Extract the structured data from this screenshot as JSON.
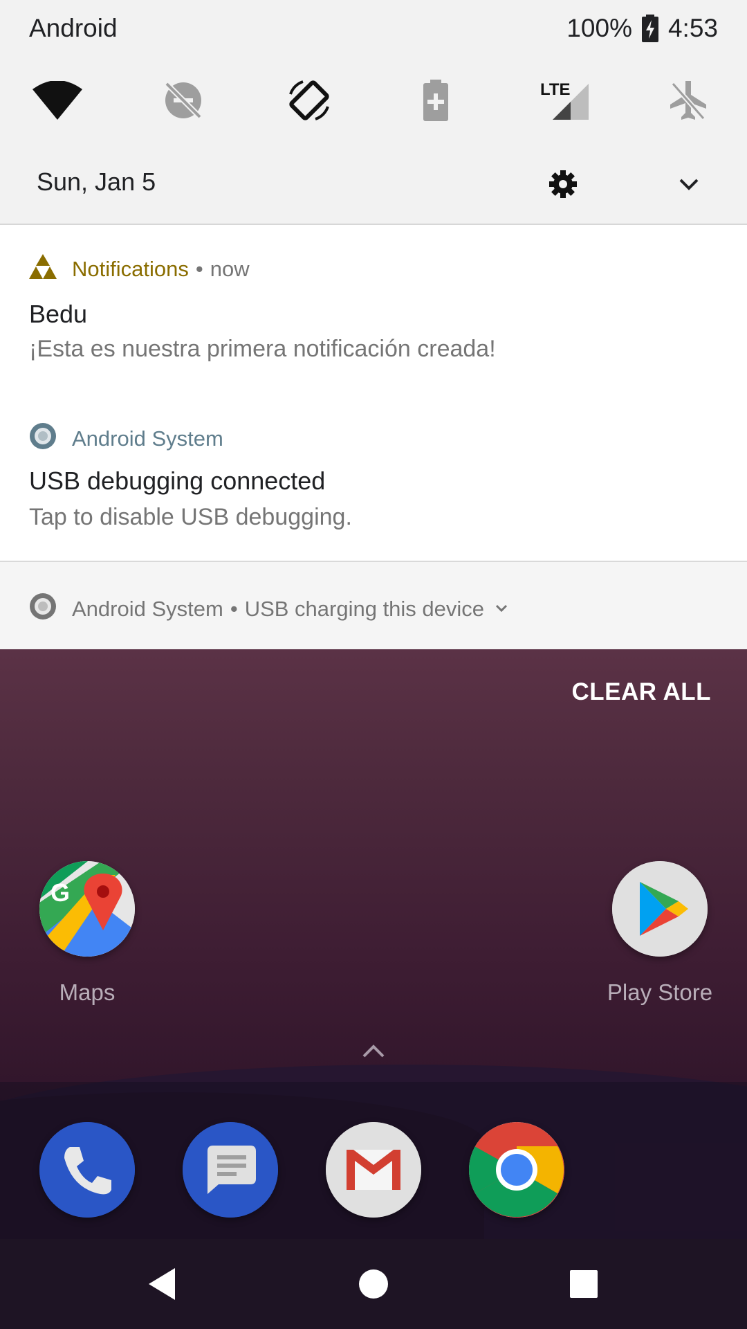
{
  "status_bar": {
    "carrier": "Android",
    "battery_percent": "100%",
    "time": "4:53",
    "icons": [
      "battery-charging-icon"
    ]
  },
  "quick_settings": {
    "tiles": [
      {
        "name": "wifi-icon"
      },
      {
        "name": "do-not-disturb-off-icon"
      },
      {
        "name": "auto-rotate-icon"
      },
      {
        "name": "battery-saver-icon"
      },
      {
        "name": "lte-signal-icon",
        "label": "LTE"
      },
      {
        "name": "airplane-mode-icon"
      }
    ],
    "date": "Sun, Jan 5",
    "settings_icon": "gear-icon",
    "expand_icon": "chevron-down-icon"
  },
  "notifications": [
    {
      "app_name": "Notifications",
      "separator": "•",
      "time": "now",
      "title": "Bedu",
      "body": "¡Esta es nuestra primera notificación creada!",
      "app_color": "#8a6d00",
      "icon": "triforce-icon"
    },
    {
      "app_name": "Android System",
      "title": "USB debugging connected",
      "body": "Tap to disable USB debugging.",
      "app_color": "#5f7d8c",
      "icon": "android-system-icon"
    }
  ],
  "collapsed_notification": {
    "app_name": "Android System",
    "separator": "•",
    "text": "USB charging this device",
    "icon": "android-system-icon"
  },
  "home": {
    "clear_all": "CLEAR ALL",
    "apps": [
      {
        "label": "Maps",
        "icon": "maps-icon"
      },
      {
        "label": "Play Store",
        "icon": "play-store-icon"
      }
    ],
    "dock": [
      "phone-icon",
      "messages-icon",
      "gmail-icon",
      "chrome-icon"
    ]
  },
  "navigation": [
    "back-icon",
    "home-icon",
    "recents-icon"
  ],
  "colors": {
    "shade_bg": "#f2f2f2",
    "accent_notifications": "#8a6d00",
    "accent_system": "#5f7d8c",
    "wallpaper_top": "#5b3246"
  }
}
